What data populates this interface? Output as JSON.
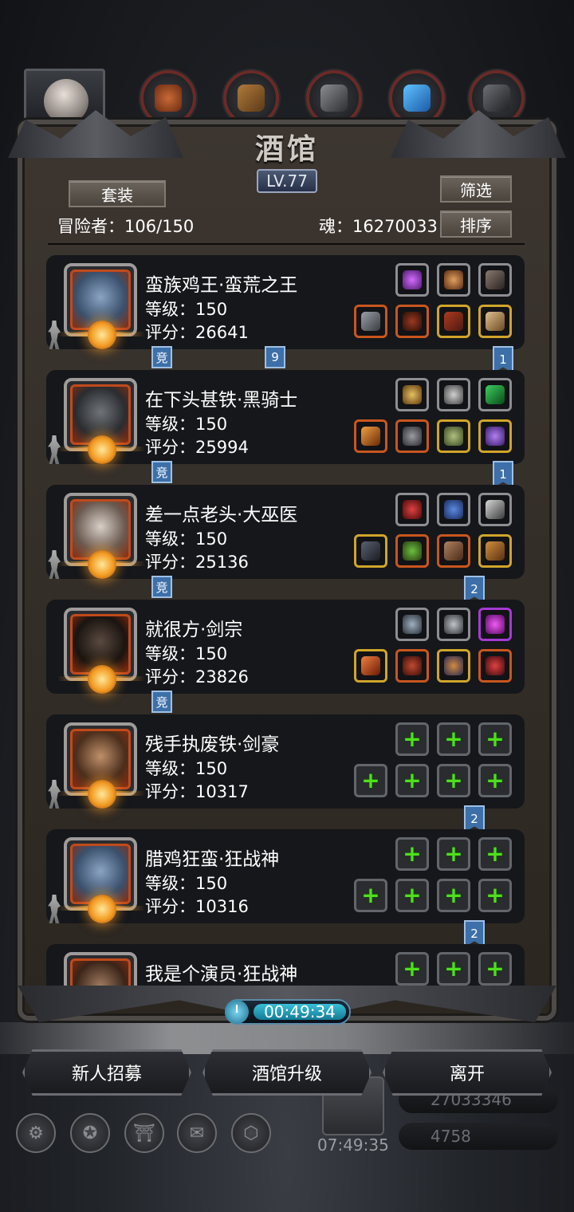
{
  "header": {
    "title": "酒馆",
    "level": "LV.77",
    "set_button": "套装",
    "filter_button": "筛选",
    "sort_button": "排序",
    "adventurers": "冒险者：106/150",
    "souls": "魂：16270033"
  },
  "tabs": [
    "portrait",
    "fist-icon",
    "wood-icon",
    "ingot-icon",
    "crystal-icon",
    "iron-icon"
  ],
  "heroes": [
    {
      "name": "蛮族鸡王·蛮荒之王",
      "level": "等级：150",
      "score": "评分：26641",
      "tag_left": "竞",
      "tag_mid": "9",
      "tag_right": "1"
    },
    {
      "name": "在下头甚铁·黑骑士",
      "level": "等级：150",
      "score": "评分：25994",
      "tag_left": "竞",
      "tag_right": "1"
    },
    {
      "name": "差一点老头·大巫医",
      "level": "等级：150",
      "score": "评分：25136",
      "tag_left": "竞",
      "tag_right": "2"
    },
    {
      "name": "就很方·剑宗",
      "level": "等级：150",
      "score": "评分：23826",
      "tag_left": "竞"
    },
    {
      "name": "残手执废铁·剑豪",
      "level": "等级：150",
      "score": "评分：10317",
      "tag_right": "2"
    },
    {
      "name": "腊鸡狂蛮·狂战神",
      "level": "等级：150",
      "score": "评分：10316",
      "tag_right": "2"
    },
    {
      "name": "我是个演员·狂战神"
    }
  ],
  "timer": "00:49:34",
  "buttons": {
    "recruit": "新人招募",
    "upgrade": "酒馆升级",
    "leave": "离开"
  },
  "background": {
    "gold": "27033346",
    "gems": "4758",
    "chest_timer": "07:49:35"
  },
  "colors": {
    "frame": "#4e4a47",
    "card": "#15171b",
    "tag": "#3d6fa8",
    "plus": "#4ee01c"
  }
}
